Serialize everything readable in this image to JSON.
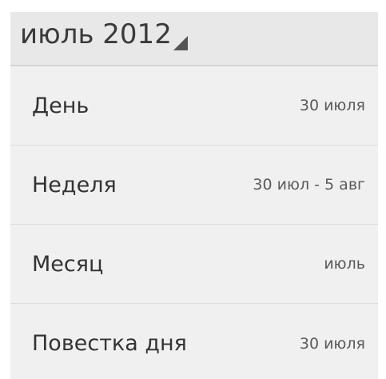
{
  "header": {
    "title": "июль 2012"
  },
  "view_options": [
    {
      "label": "День",
      "value": "30 июля"
    },
    {
      "label": "Неделя",
      "value": "30 июл - 5 авг"
    },
    {
      "label": "Месяц",
      "value": "июль"
    },
    {
      "label": "Повестка дня",
      "value": "30 июля"
    }
  ],
  "colors": {
    "header_background": "#e8e8e8",
    "list_background": "#f0f0f0",
    "divider": "#dcdcdc"
  }
}
